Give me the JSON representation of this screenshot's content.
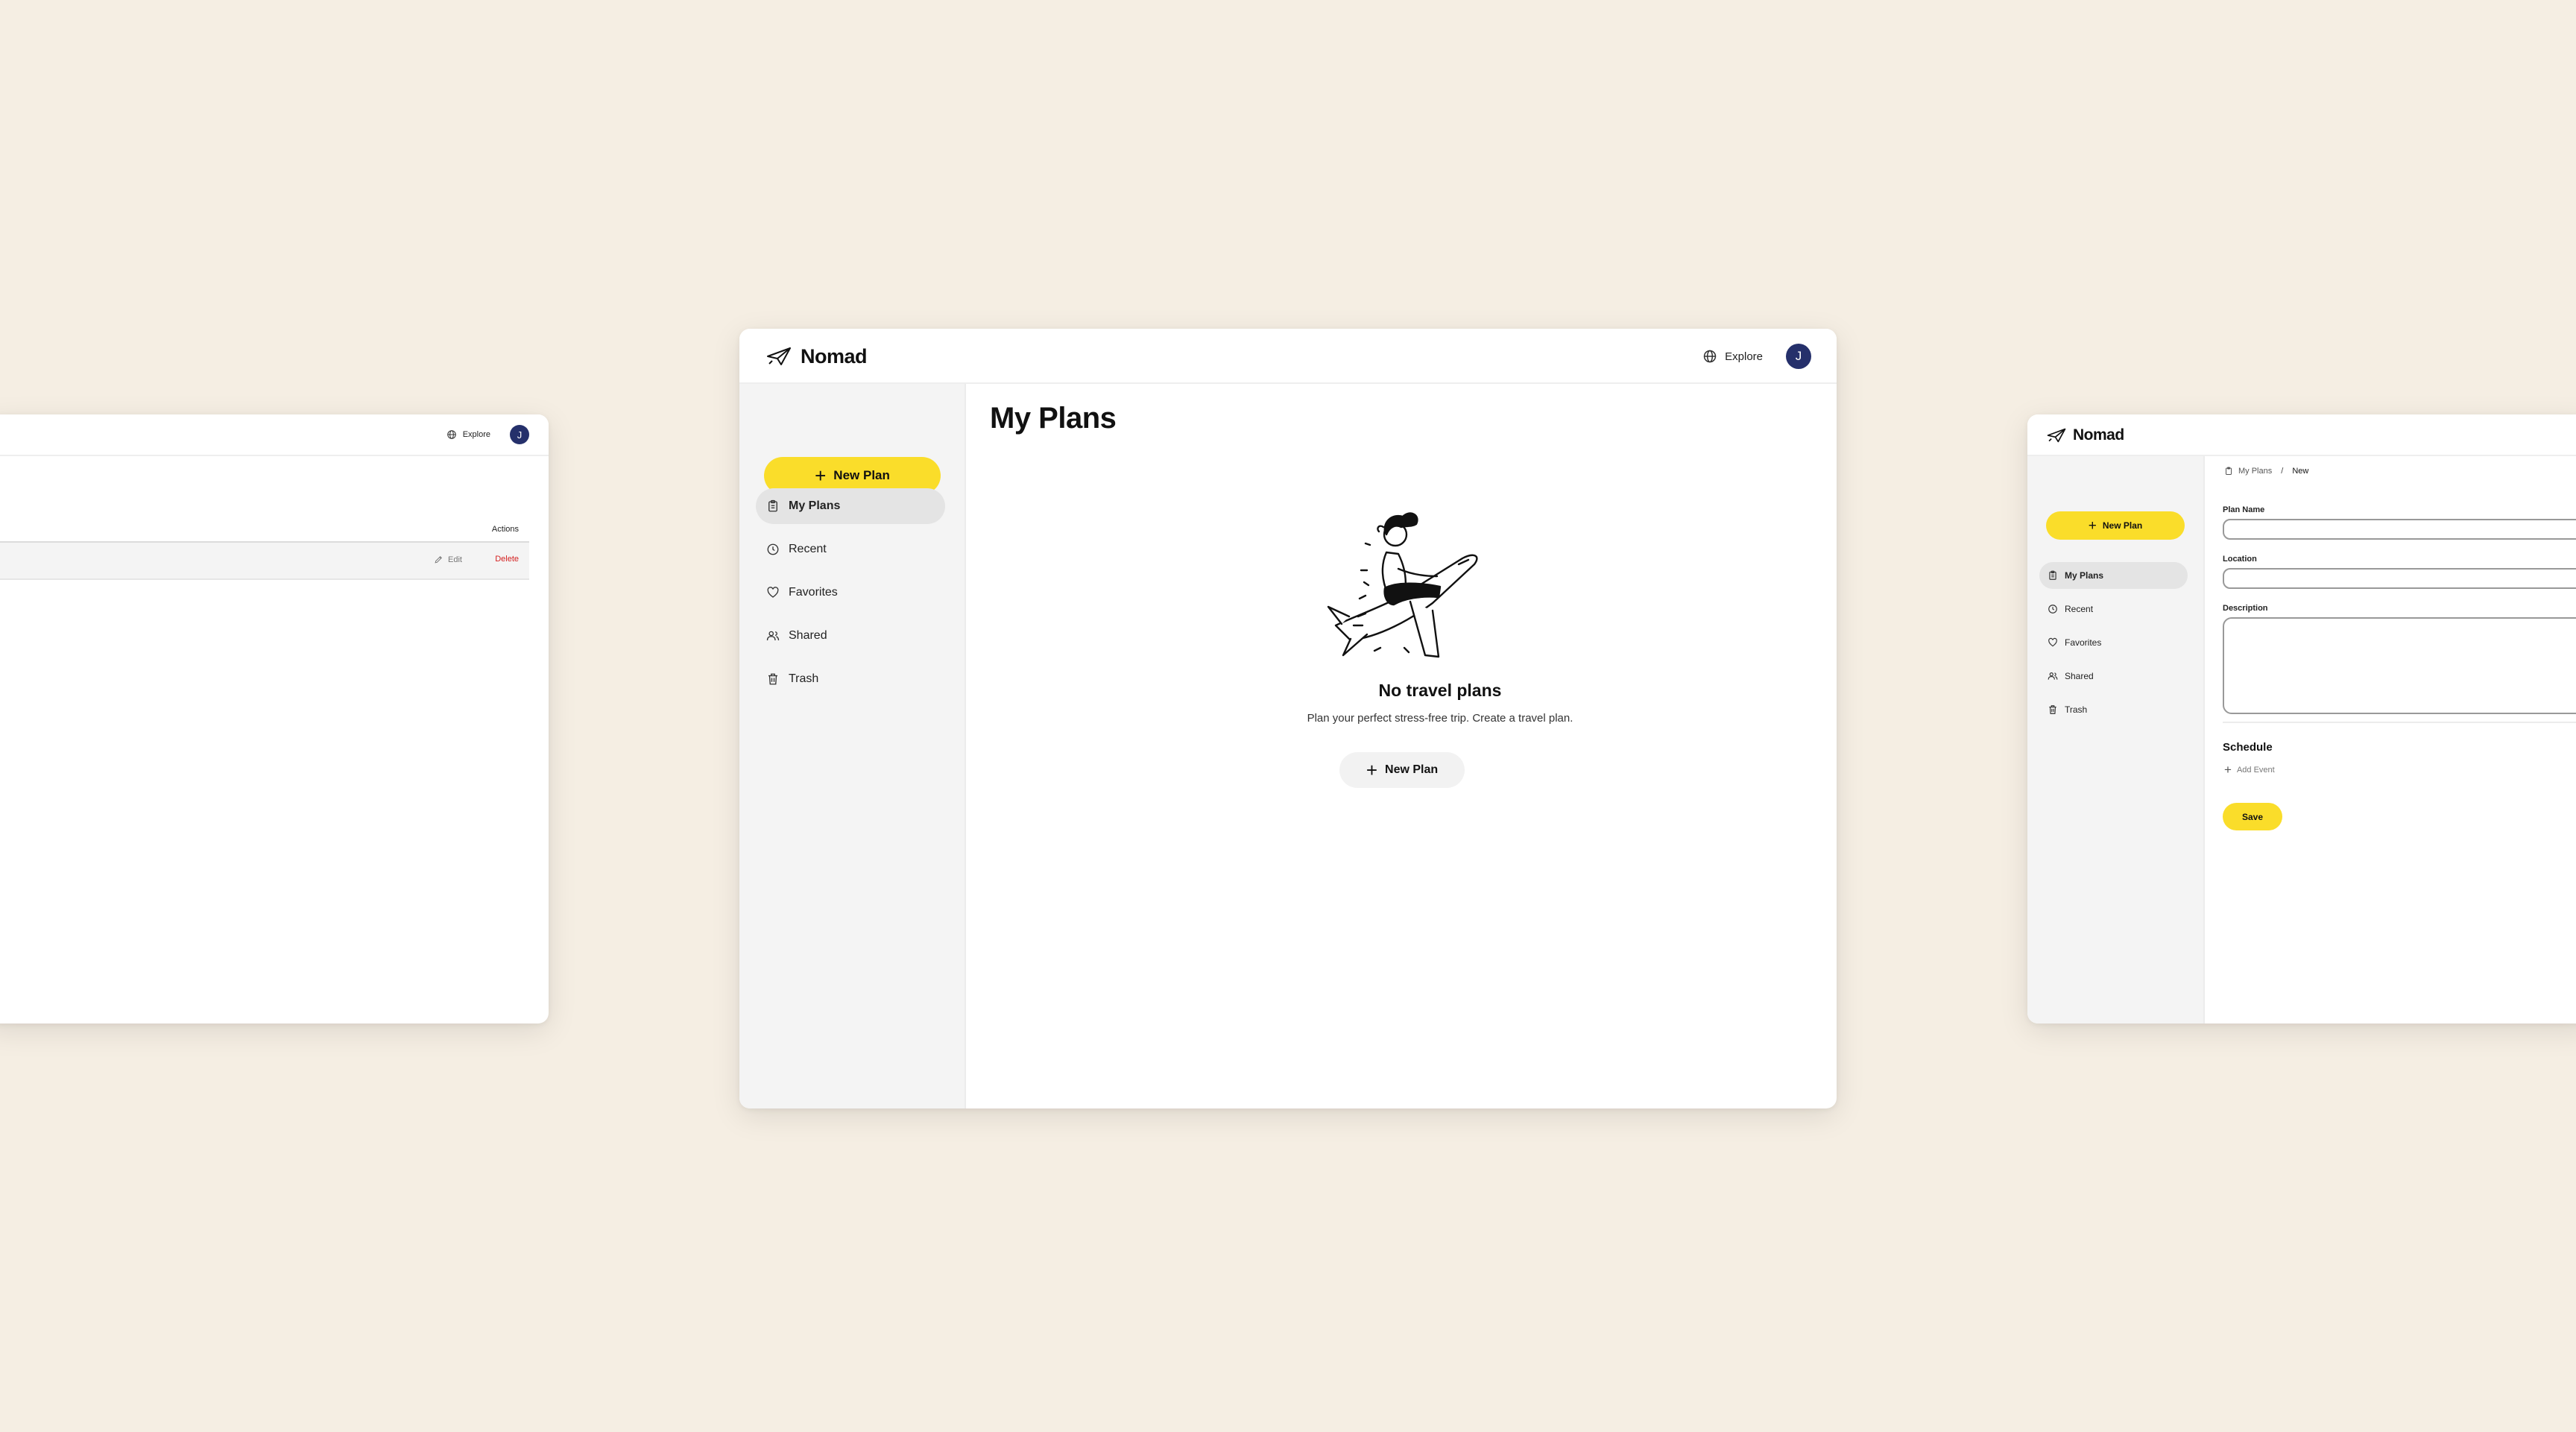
{
  "left_window": {
    "header": {
      "explore_label": "Explore",
      "avatar_initial": "J"
    },
    "table": {
      "actions_header": "Actions",
      "rows": [
        {
          "edit_label": "Edit",
          "delete_label": "Delete"
        }
      ]
    }
  },
  "main_window": {
    "header": {
      "brand": "Nomad",
      "explore_label": "Explore",
      "avatar_initial": "J"
    },
    "sidebar": {
      "new_plan_label": "New Plan",
      "items": [
        {
          "label": "My Plans",
          "icon": "clipboard-icon",
          "active": true
        },
        {
          "label": "Recent",
          "icon": "clock-icon",
          "active": false
        },
        {
          "label": "Favorites",
          "icon": "heart-icon",
          "active": false
        },
        {
          "label": "Shared",
          "icon": "users-icon",
          "active": false
        },
        {
          "label": "Trash",
          "icon": "trash-icon",
          "active": false
        }
      ]
    },
    "content": {
      "title": "My Plans",
      "empty_title": "No travel plans",
      "empty_subtitle": "Plan your perfect stress-free trip. Create a travel plan.",
      "empty_button_label": "New Plan"
    }
  },
  "right_window": {
    "header": {
      "brand": "Nomad"
    },
    "sidebar": {
      "new_plan_label": "New Plan",
      "items": [
        {
          "label": "My Plans",
          "active": true
        },
        {
          "label": "Recent",
          "active": false
        },
        {
          "label": "Favorites",
          "active": false
        },
        {
          "label": "Shared",
          "active": false
        },
        {
          "label": "Trash",
          "active": false
        }
      ]
    },
    "breadcrumb": {
      "parent": "My Plans",
      "separator": "/",
      "current": "New"
    },
    "form": {
      "plan_name_label": "Plan Name",
      "plan_name_value": "",
      "location_label": "Location",
      "location_value": "",
      "description_label": "Description",
      "description_value": "",
      "schedule_title": "Schedule",
      "add_event_label": "Add Event",
      "save_label": "Save"
    }
  },
  "colors": {
    "background": "#f5eee3",
    "accent_yellow": "#fadd2a",
    "avatar_navy": "#25306b",
    "delete_red": "#d42020",
    "sidebar_bg": "#f4f4f4"
  }
}
